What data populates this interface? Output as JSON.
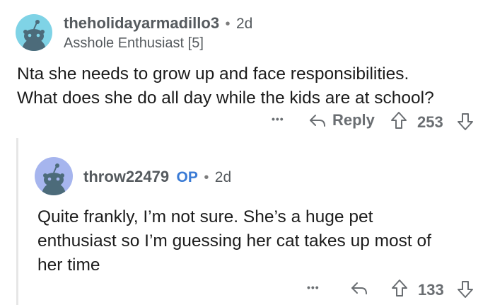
{
  "comment1": {
    "username": "theholidayarmadillo3",
    "separator": "•",
    "time": "2d",
    "flair": "Asshole Enthusiast [5]",
    "body_lines": [
      "Nta she needs to grow up and face responsibilities.",
      "What does she do all day while the kids are at school?"
    ],
    "more": "•••",
    "reply_label": "Reply",
    "score": "253",
    "avatar_color": "#7fd3e6"
  },
  "comment2": {
    "username": "throw22479",
    "op_badge": "OP",
    "separator": "•",
    "time": "2d",
    "body_lines": [
      "Quite frankly, I’m not sure. She’s a huge pet",
      "enthusiast so I’m guessing her cat takes up most of",
      "her time"
    ],
    "more": "•••",
    "score": "133",
    "avatar_color": "#a6b5ee"
  },
  "icons": [
    "snoo-avatar-icon",
    "reply-arrow-icon",
    "upvote-icon",
    "downvote-icon",
    "more-options-icon"
  ],
  "colors": {
    "op_blue": "#3a7bd5",
    "meta_gray": "#555a5e",
    "icon_gray": "#6a6e72"
  }
}
